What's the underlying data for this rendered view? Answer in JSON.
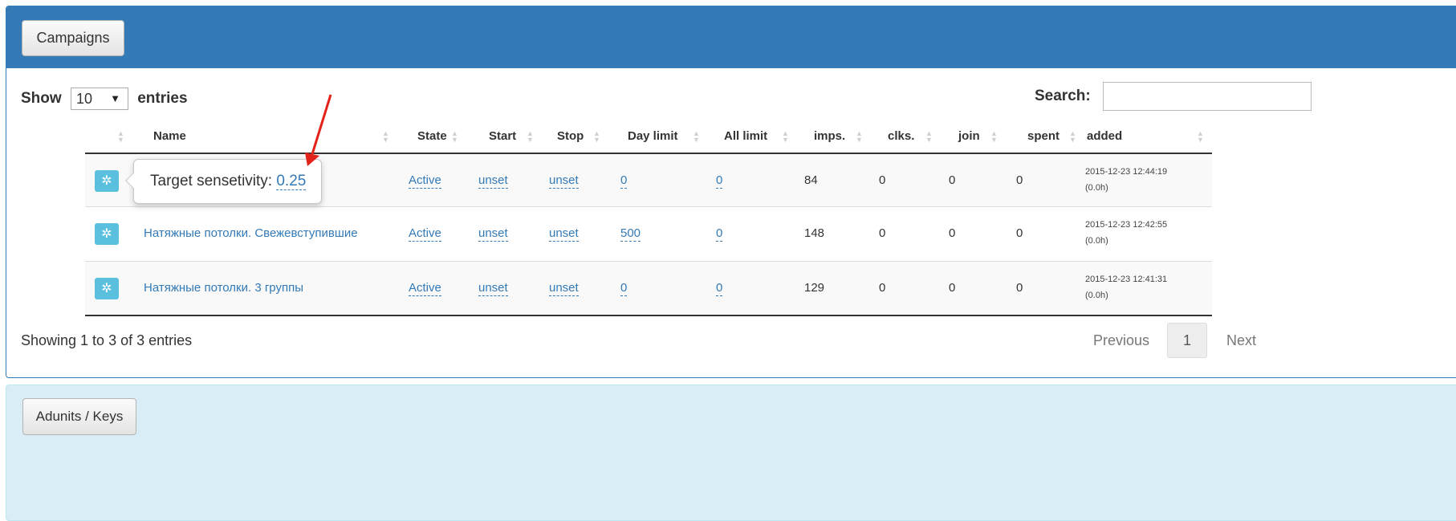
{
  "campaigns_panel": {
    "button_label": "Campaigns"
  },
  "length": {
    "show_label": "Show",
    "value": "10",
    "caret": "▼",
    "entries_label": "entries"
  },
  "search": {
    "label": "Search:",
    "value": ""
  },
  "table": {
    "headers": [
      "Name",
      "State",
      "Start",
      "Stop",
      "Day limit",
      "All limit",
      "imps.",
      "clks.",
      "join",
      "spent",
      "added"
    ],
    "rows": [
      {
        "name": "",
        "state": "Active",
        "start": "unset",
        "stop": "unset",
        "day_limit": "0",
        "all_limit": "0",
        "imps": "84",
        "clks": "0",
        "join": "0",
        "spent": "0",
        "added_date": "2015-12-23 12:44:19",
        "added_age": "(0.0h)"
      },
      {
        "name": "Натяжные потолки. Свежевступившие",
        "state": "Active",
        "start": "unset",
        "stop": "unset",
        "day_limit": "500",
        "all_limit": "0",
        "imps": "148",
        "clks": "0",
        "join": "0",
        "spent": "0",
        "added_date": "2015-12-23 12:42:55",
        "added_age": "(0.0h)"
      },
      {
        "name": "Натяжные потолки. 3 группы",
        "state": "Active",
        "start": "unset",
        "stop": "unset",
        "day_limit": "0",
        "all_limit": "0",
        "imps": "129",
        "clks": "0",
        "join": "0",
        "spent": "0",
        "added_date": "2015-12-23 12:41:31",
        "added_age": "(0.0h)"
      }
    ]
  },
  "popover": {
    "label": "Target sensetivity:",
    "value": "0.25"
  },
  "footer": {
    "info": "Showing 1 to 3 of 3 entries",
    "previous": "Previous",
    "page": "1",
    "next": "Next"
  },
  "adunits_panel": {
    "button_label": "Adunits / Keys"
  },
  "icons": {
    "settings": "gear-icon",
    "sort": "sort-both-icon",
    "annotation": "red-arrow"
  },
  "colors": {
    "primary": "#337ab7",
    "info_button": "#5bc0de",
    "info_panel": "#d9edf7",
    "annotation_arrow": "#e32219"
  }
}
